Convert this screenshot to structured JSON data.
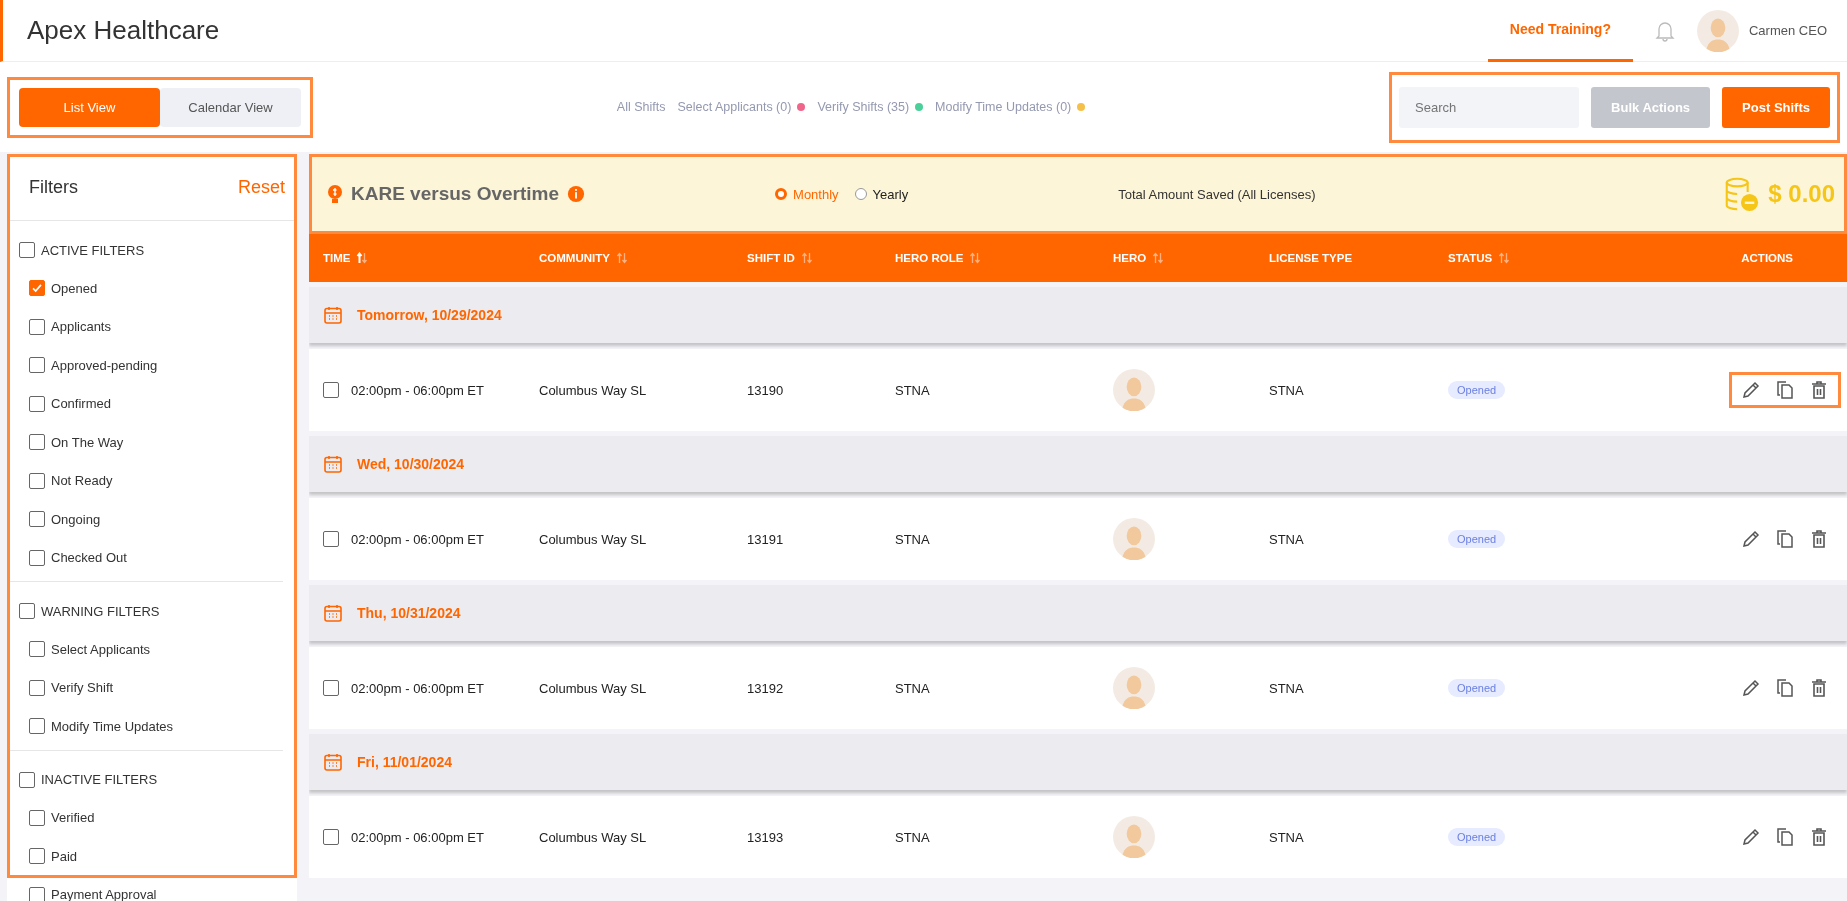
{
  "app": {
    "title": "Apex Healthcare"
  },
  "top_nav": {
    "training_link": "Need Training?",
    "training_selected": true,
    "user_name": "Carmen CEO"
  },
  "view_tabs": {
    "highlighted": true,
    "tabs": [
      {
        "label": "List View",
        "selected": true
      },
      {
        "label": "Calendar View",
        "selected": false
      }
    ]
  },
  "shift_links": [
    {
      "label": "All Shifts"
    },
    {
      "label": "Select Applicants (0)",
      "color": "#f0668a"
    },
    {
      "label": "Verify Shifts (35)",
      "color": "#4cd09a"
    },
    {
      "label": "Modify Time Updates (0)",
      "color": "#f5c04a"
    }
  ],
  "toolbar": {
    "highlighted": true,
    "search": {
      "placeholder": "Search"
    },
    "bulk_button": {
      "label": "Bulk Actions",
      "disabled": true
    },
    "post_button": {
      "label": "Post Shifts"
    }
  },
  "filters": {
    "highlighted": true,
    "title": "Filters",
    "reset": "Reset",
    "groups": [
      {
        "label": "ACTIVE FILTERS",
        "checked": false,
        "items": [
          {
            "label": "Opened",
            "checked": true
          },
          {
            "label": "Applicants",
            "checked": false
          },
          {
            "label": "Approved-pending",
            "checked": false
          },
          {
            "label": "Confirmed",
            "checked": false
          },
          {
            "label": "On The Way",
            "checked": false
          },
          {
            "label": "Not Ready",
            "checked": false
          },
          {
            "label": "Ongoing",
            "checked": false
          },
          {
            "label": "Checked Out",
            "checked": false
          }
        ]
      },
      {
        "label": "WARNING FILTERS",
        "checked": false,
        "items": [
          {
            "label": "Select Applicants",
            "checked": false
          },
          {
            "label": "Verify Shift",
            "checked": false
          },
          {
            "label": "Modify Time Updates",
            "checked": false
          }
        ]
      },
      {
        "label": "INACTIVE FILTERS",
        "checked": false,
        "items": [
          {
            "label": "Verified",
            "checked": false
          },
          {
            "label": "Paid",
            "checked": false
          },
          {
            "label": "Payment Approval",
            "checked": false
          }
        ]
      }
    ]
  },
  "savings_banner": {
    "highlighted": true,
    "title": "KARE versus Overtime",
    "periods": [
      {
        "label": "Monthly",
        "selected": true
      },
      {
        "label": "Yearly",
        "selected": false
      }
    ],
    "total_label": "Total Amount Saved (All Licenses)",
    "total": "$ 0.00"
  },
  "table": {
    "columns": [
      {
        "label": "TIME",
        "sortable": true,
        "sorted": true
      },
      {
        "label": "COMMUNITY",
        "sortable": true,
        "sorted": false
      },
      {
        "label": "SHIFT ID",
        "sortable": true,
        "sorted": false
      },
      {
        "label": "HERO ROLE",
        "sortable": true,
        "sorted": false
      },
      {
        "label": "HERO",
        "sortable": true,
        "sorted": false
      },
      {
        "label": "LICENSE TYPE",
        "sortable": false,
        "sorted": false
      },
      {
        "label": "STATUS",
        "sortable": true,
        "sorted": false
      },
      {
        "label": "ACTIONS",
        "sortable": false,
        "sorted": false
      }
    ],
    "groups": [
      {
        "date": "Tomorrow, 10/29/2024",
        "rows": [
          {
            "checked": false,
            "time": "02:00pm - 06:00pm ET",
            "community": "Columbus Way SL",
            "shift_id": "13190",
            "hero_role": "STNA",
            "license_type": "STNA",
            "status": "Opened",
            "actions_highlighted": true
          }
        ]
      },
      {
        "date": "Wed, 10/30/2024",
        "rows": [
          {
            "checked": false,
            "time": "02:00pm - 06:00pm ET",
            "community": "Columbus Way SL",
            "shift_id": "13191",
            "hero_role": "STNA",
            "license_type": "STNA",
            "status": "Opened",
            "actions_highlighted": false
          }
        ]
      },
      {
        "date": "Thu, 10/31/2024",
        "rows": [
          {
            "checked": false,
            "time": "02:00pm - 06:00pm ET",
            "community": "Columbus Way SL",
            "shift_id": "13192",
            "hero_role": "STNA",
            "license_type": "STNA",
            "status": "Opened",
            "actions_highlighted": false
          }
        ]
      },
      {
        "date": "Fri, 11/01/2024",
        "rows": [
          {
            "checked": false,
            "time": "02:00pm - 06:00pm ET",
            "community": "Columbus Way SL",
            "shift_id": "13193",
            "hero_role": "STNA",
            "license_type": "STNA",
            "status": "Opened",
            "actions_highlighted": false
          }
        ]
      }
    ]
  }
}
